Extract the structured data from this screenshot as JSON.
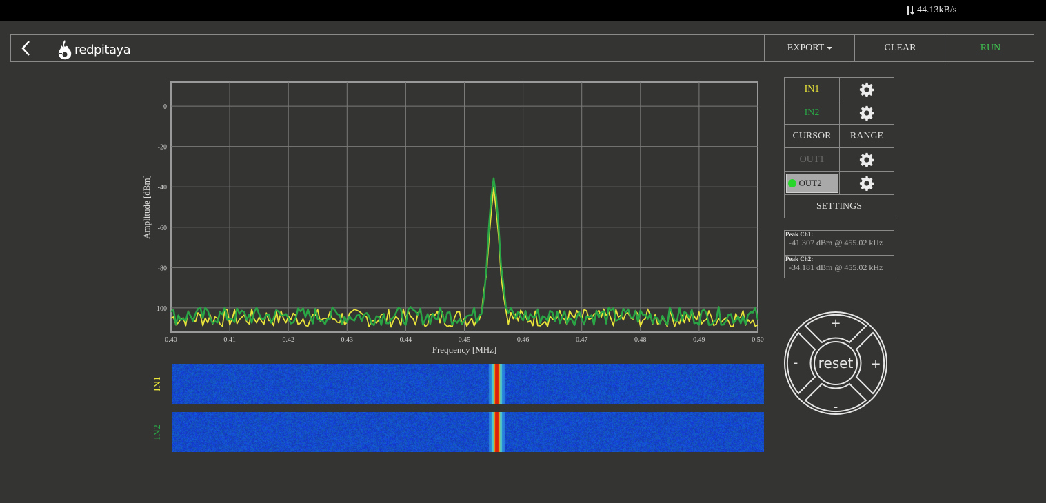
{
  "status": {
    "rate": "44.13kB/s"
  },
  "header": {
    "logo": "redpitaya",
    "export_label": "EXPORT",
    "clear_label": "CLEAR",
    "run_label": "RUN"
  },
  "chart_data": {
    "type": "line",
    "xlabel": "Frequency [MHz]",
    "ylabel": "Amplitude [dBm]",
    "xlim": [
      0.4,
      0.5
    ],
    "ylim": [
      -112,
      12
    ],
    "xticks": [
      "0.40",
      "0.41",
      "0.42",
      "0.43",
      "0.44",
      "0.45",
      "0.46",
      "0.47",
      "0.48",
      "0.49",
      "0.50"
    ],
    "yticks": [
      "0",
      "-20",
      "-40",
      "-60",
      "-80",
      "-100"
    ],
    "grid": true,
    "series": [
      {
        "name": "IN1",
        "color": "#e9e43a",
        "noise_floor": -105,
        "peak_x": 0.455,
        "peak_y": -41.3
      },
      {
        "name": "IN2",
        "color": "#2aa545",
        "noise_floor": -104,
        "peak_x": 0.455,
        "peak_y": -34.2
      }
    ]
  },
  "waterfall": [
    {
      "label": "IN1",
      "color": "#e9e43a"
    },
    {
      "label": "IN2",
      "color": "#2aa545"
    }
  ],
  "panel": {
    "in1": "IN1",
    "in2": "IN2",
    "cursor": "CURSOR",
    "range": "RANGE",
    "out1": "OUT1",
    "out2": "OUT2",
    "settings": "SETTINGS",
    "in1_color": "#e9e43a",
    "in2_color": "#2aa545",
    "out1_color": "#6e6e6e"
  },
  "peaks": [
    {
      "title": "Peak Ch1:",
      "value": "-41.307 dBm @ 455.02 kHz"
    },
    {
      "title": "Peak Ch2:",
      "value": "-34.181 dBm @ 455.02 kHz"
    }
  ],
  "dpad": {
    "up": "+",
    "down": "-",
    "left": "-",
    "right": "+",
    "center": "reset"
  }
}
